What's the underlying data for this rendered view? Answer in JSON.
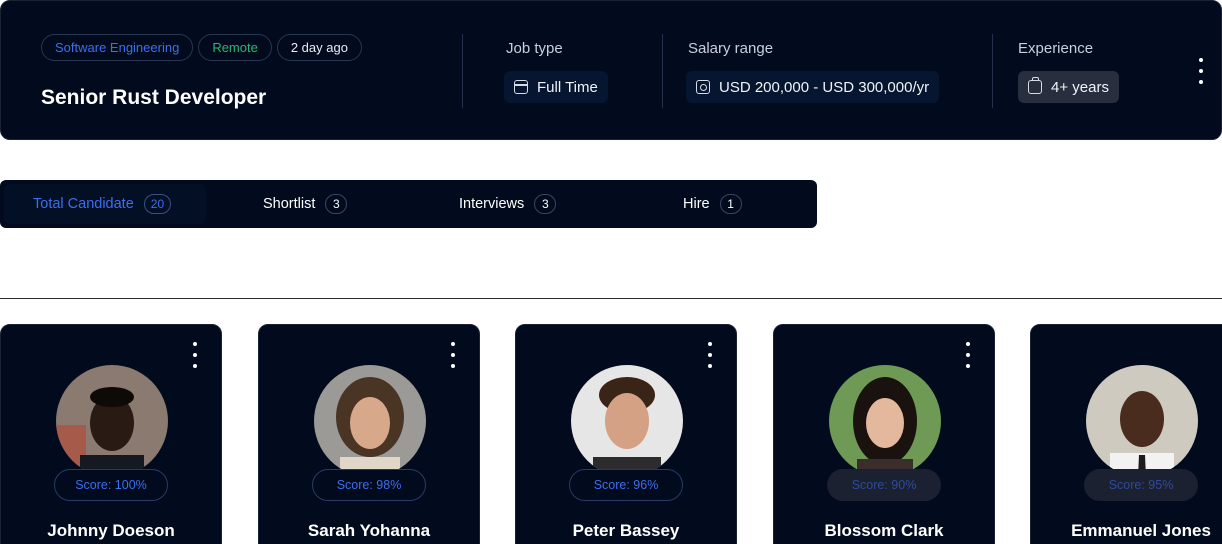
{
  "job": {
    "tags": [
      "Software Engineering",
      "Remote",
      "2 day ago"
    ],
    "title": "Senior Rust Developer",
    "job_type": {
      "label": "Job type",
      "value": "Full Time",
      "icon": "calendar-icon"
    },
    "salary": {
      "label": "Salary range",
      "value": "USD 200,000 - USD 300,000/yr",
      "icon": "money-icon"
    },
    "experience": {
      "label": "Experience",
      "value": "4+ years",
      "icon": "briefcase-icon"
    }
  },
  "tabs": [
    {
      "label": "Total Candidate",
      "count": "20",
      "active": true
    },
    {
      "label": "Shortlist",
      "count": "3",
      "active": false
    },
    {
      "label": "Interviews",
      "count": "3",
      "active": false
    },
    {
      "label": "Hire",
      "count": "1",
      "active": false
    }
  ],
  "candidates": [
    {
      "name": "Johnny Doeson",
      "score": "Score: 100%"
    },
    {
      "name": "Sarah Yohanna",
      "score": "Score: 98%"
    },
    {
      "name": "Peter Bassey",
      "score": "Score: 96%"
    },
    {
      "name": "Blossom Clark",
      "score": "Score: 90%"
    },
    {
      "name": "Emmanuel Jones",
      "score": "Score: 95%"
    }
  ],
  "colors": {
    "card_bg": "#010b1d",
    "accent_blue": "#3b6ff0",
    "tag_green": "#2bb673"
  }
}
